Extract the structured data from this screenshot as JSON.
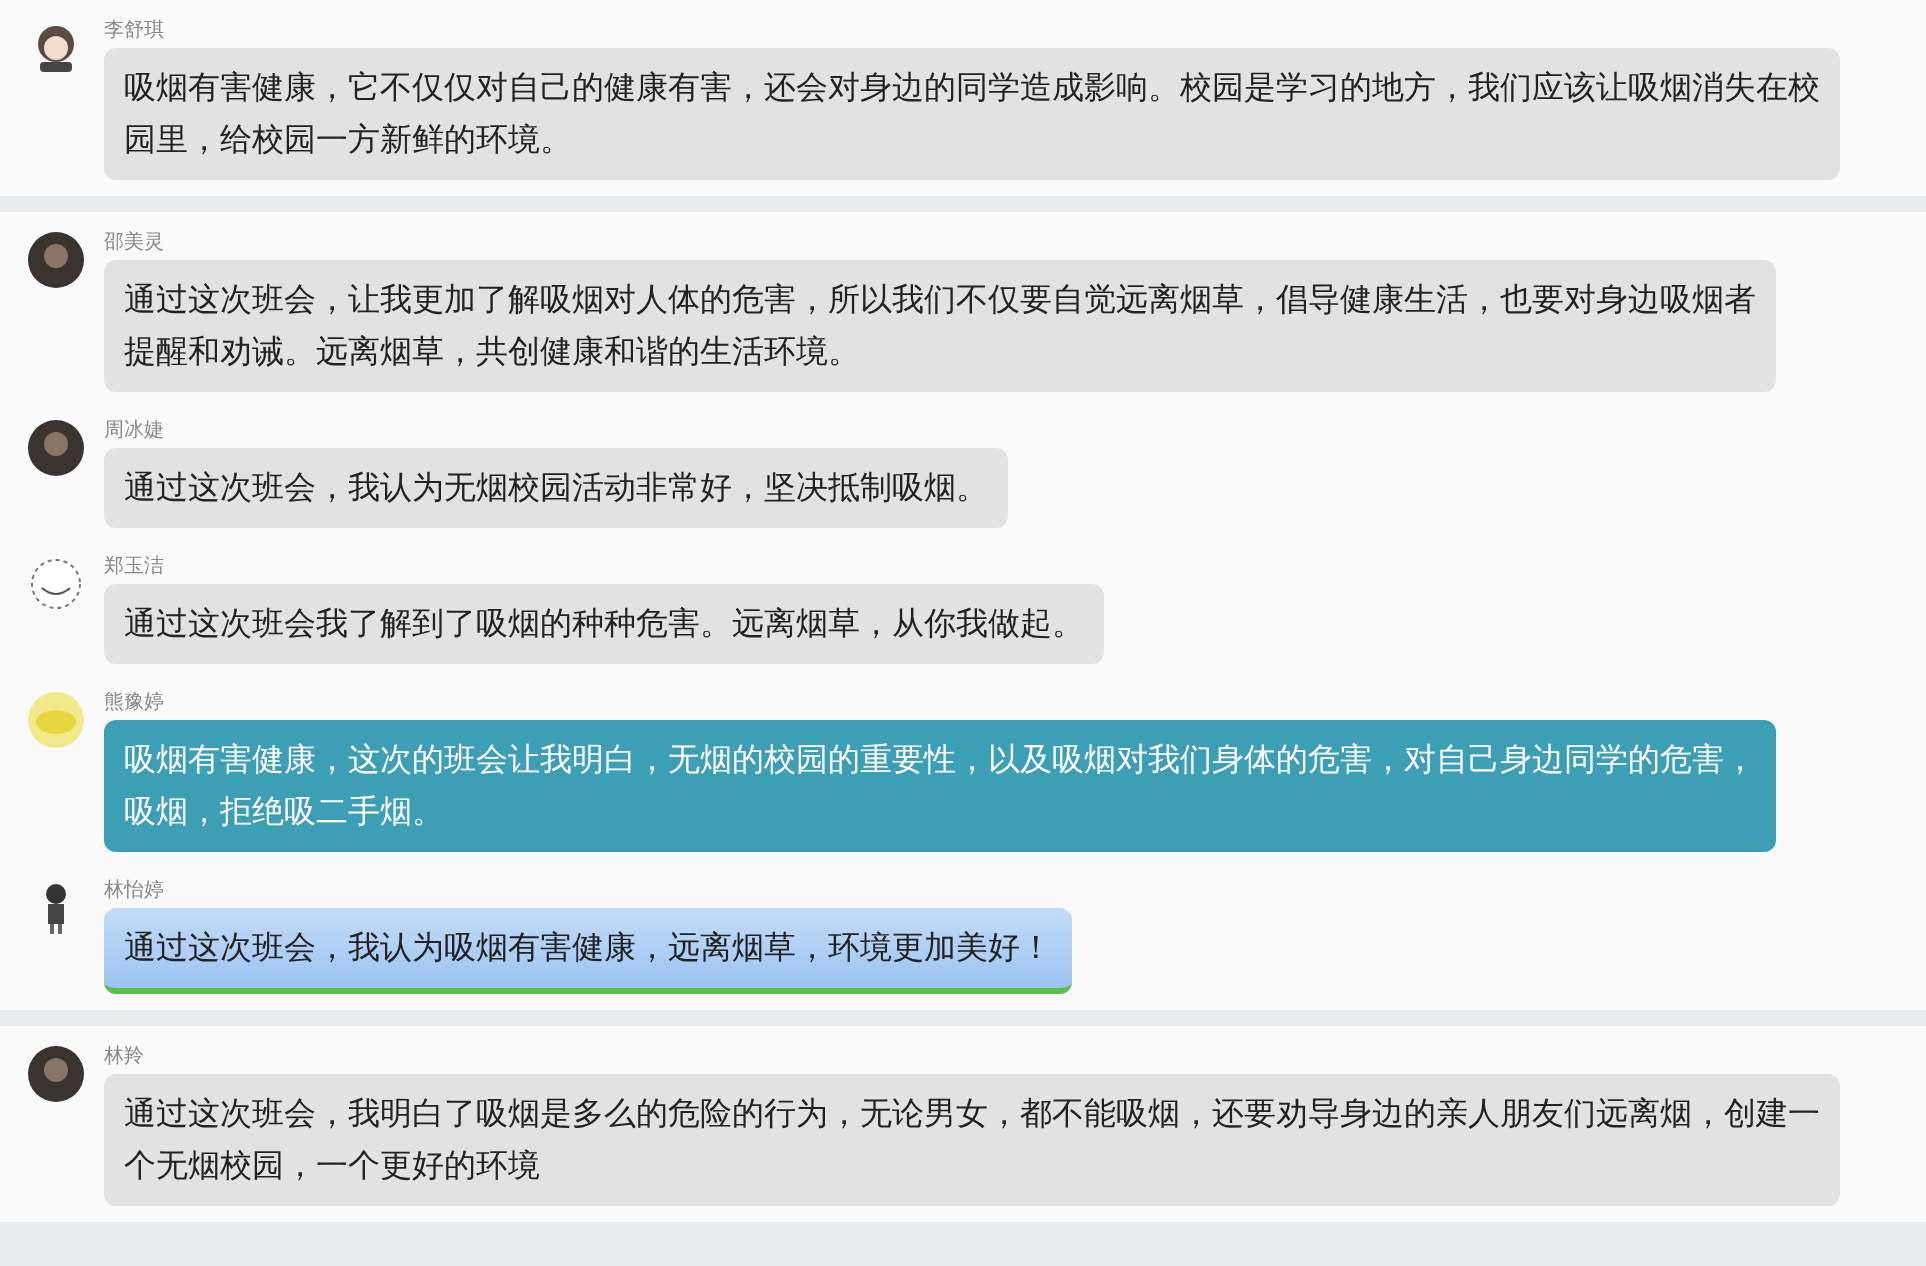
{
  "panels": [
    {
      "messages": [
        {
          "sender": "李舒琪",
          "avatar": {
            "kind": "cartoon"
          },
          "kind": "plain",
          "lines": [
            "吸烟有害健康，它不仅仅对自己的健康有害，还会对身边的同学造成影响。校园是学习的地方，我们应该让吸烟消失在校",
            "园里，给校园一方新鲜的环境。"
          ]
        }
      ]
    },
    {
      "messages": [
        {
          "sender": "邵美灵",
          "avatar": {
            "kind": "dark"
          },
          "kind": "plain",
          "lines": [
            "通过这次班会，让我更加了解吸烟对人体的危害，所以我们不仅要自觉远离烟草，倡导健康生活，也要对身边吸烟者",
            "提醒和劝诫。远离烟草，共创健康和谐的生活环境。"
          ]
        },
        {
          "sender": "周冰婕",
          "avatar": {
            "kind": "dark"
          },
          "kind": "plain",
          "lines": [
            "通过这次班会，我认为无烟校园活动非常好，坚决抵制吸烟。"
          ]
        },
        {
          "sender": "郑玉洁",
          "avatar": {
            "kind": "sketch"
          },
          "kind": "plain",
          "lines": [
            "通过这次班会我了解到了吸烟的种种危害。远离烟草，从你我做起。"
          ]
        },
        {
          "sender": "熊豫婷",
          "avatar": {
            "kind": "yellow"
          },
          "kind": "teal",
          "lines": [
            "吸烟有害健康，这次的班会让我明白，无烟的校园的重要性，以及吸烟对我们身体的危害，对自己身边同学的危害，",
            "吸烟，拒绝吸二手烟。"
          ]
        },
        {
          "sender": "林怡婷",
          "avatar": {
            "kind": "figure"
          },
          "kind": "blue",
          "lines": [
            "通过这次班会，我认为吸烟有害健康，远离烟草，环境更加美好！"
          ]
        }
      ]
    },
    {
      "messages": [
        {
          "sender": "林羚",
          "avatar": {
            "kind": "dark"
          },
          "kind": "plain",
          "lines": [
            "通过这次班会，我明白了吸烟是多么的危险的行为，无论男女，都不能吸烟，还要劝导身边的亲人朋友们远离烟，创建一",
            "个无烟校园，一个更好的环境"
          ]
        }
      ]
    }
  ]
}
